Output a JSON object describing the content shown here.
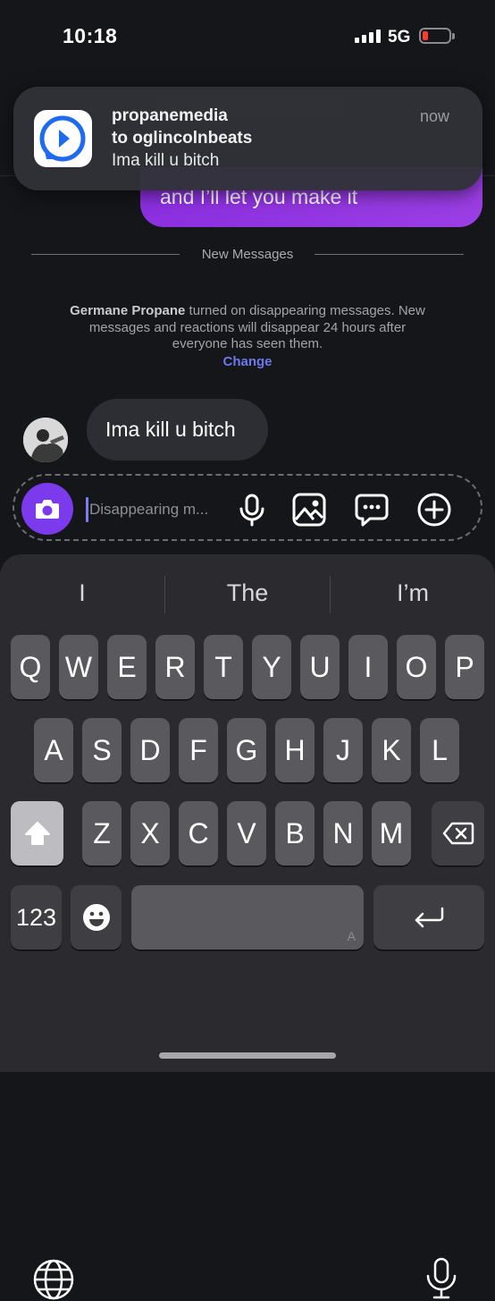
{
  "status_bar": {
    "time": "10:18",
    "network": "5G",
    "battery_color": "#ff3b30"
  },
  "notification": {
    "app_icon": "message-app-icon",
    "sender": "propanemedia",
    "recipient_line": "to oglincolnbeats",
    "message": "Ima kill u bitch",
    "time": "now"
  },
  "thread": {
    "sent_message": "and I’ll let you make it",
    "divider_label": "New Messages",
    "system_notice": {
      "actor": "Germane Propane",
      "text": " turned on disappearing messages. New messages and reactions will disappear 24 hours after everyone has seen them.",
      "action": "Change"
    },
    "received_message": "Ima kill u bitch"
  },
  "composer": {
    "placeholder": "Disappearing m...",
    "icons": [
      "camera-icon",
      "microphone-icon",
      "gallery-icon",
      "chat-bubble-icon",
      "add-icon"
    ]
  },
  "keyboard": {
    "suggestions": [
      "I",
      "The",
      "I’m"
    ],
    "row1": [
      "Q",
      "W",
      "E",
      "R",
      "T",
      "Y",
      "U",
      "I",
      "O",
      "P"
    ],
    "row2": [
      "A",
      "S",
      "D",
      "F",
      "G",
      "H",
      "J",
      "K",
      "L"
    ],
    "row3": [
      "Z",
      "X",
      "C",
      "V",
      "B",
      "N",
      "M"
    ],
    "numbers_key": "123",
    "space_mark": "A"
  },
  "colors": {
    "accent": "#7c3aed",
    "sent_bubble": "#9b3ee4",
    "link": "#6d77ee"
  }
}
